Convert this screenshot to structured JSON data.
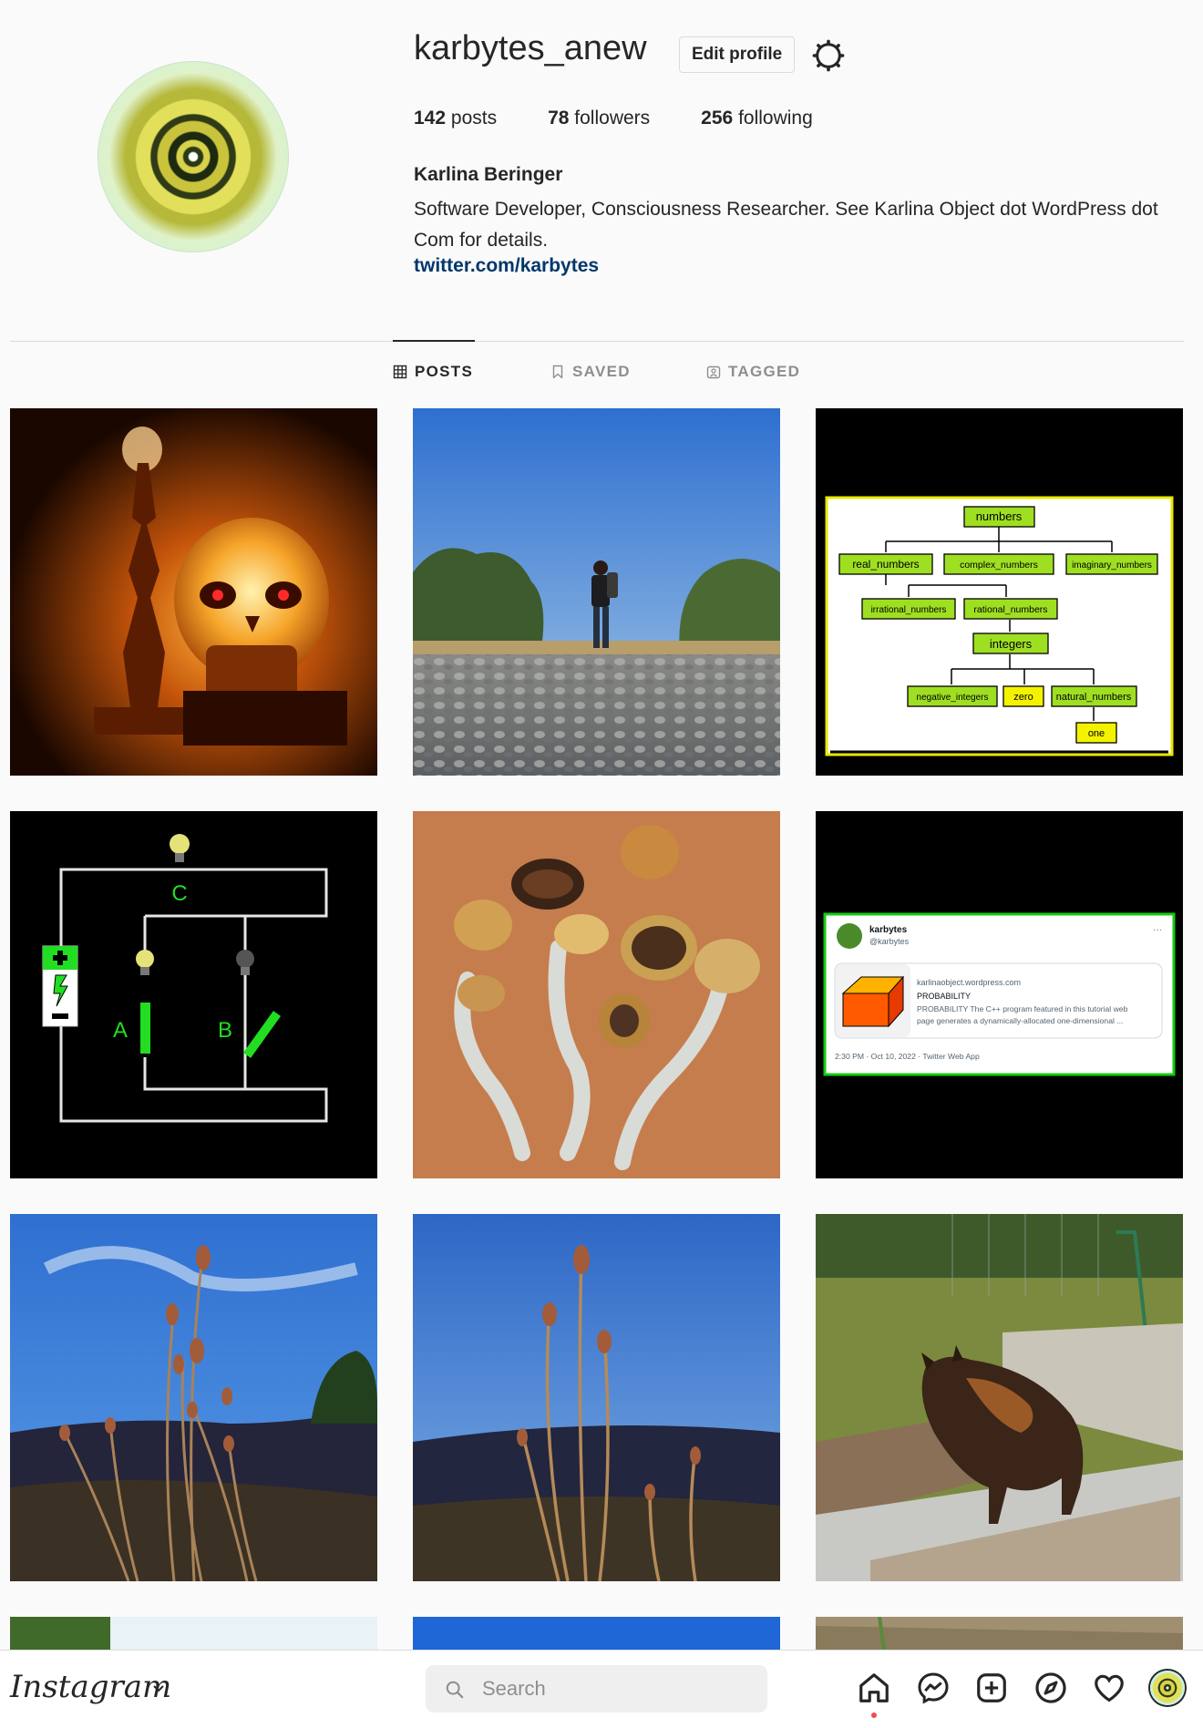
{
  "profile": {
    "username": "karbytes_anew",
    "edit_label": "Edit profile",
    "posts_count": "142",
    "posts_label": "posts",
    "followers_count": "78",
    "followers_label": "followers",
    "following_count": "256",
    "following_label": "following",
    "full_name": "Karlina Beringer",
    "bio": "Software Developer, Consciousness Researcher. See Karlina Object dot WordPress dot Com for details.",
    "link": "twitter.com/karbytes"
  },
  "tabs": {
    "posts": "POSTS",
    "saved": "SAVED",
    "tagged": "TAGGED",
    "active": "posts"
  },
  "posts": {
    "tree": {
      "root": "numbers",
      "real": "real_numbers",
      "complex": "complex_numbers",
      "imaginary": "imaginary_numbers",
      "irrational": "irrational_numbers",
      "rational": "rational_numbers",
      "integers": "integers",
      "negative": "negative_integers",
      "zero": "zero",
      "natural": "natural_numbers",
      "one": "one"
    },
    "circuit": {
      "label_a": "A",
      "label_b": "B",
      "label_c": "C"
    },
    "tweet": {
      "name": "karbytes",
      "handle": "@karbytes",
      "more": "···",
      "domain": "karlinaobject.wordpress.com",
      "card_title": "PROBABILITY",
      "card_desc_1": "PROBABILITY The C++ program featured in this tutorial web",
      "card_desc_2": "page generates a dynamically-allocated one-dimensional ...",
      "meta": "2:30 PM · Oct 10, 2022 · Twitter Web App"
    }
  },
  "bottombar": {
    "logo": "Instagram",
    "search_placeholder": "Search"
  },
  "colors": {
    "link": "#00376b",
    "accent_green": "#00cc00",
    "notification": "#ed4956"
  }
}
